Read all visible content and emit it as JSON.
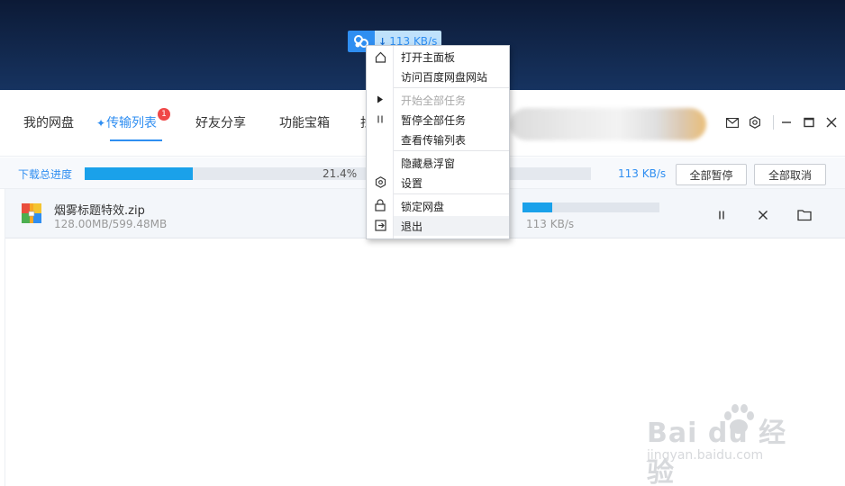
{
  "floating_ball": {
    "speed": "113 KB/s",
    "arrow": "↓"
  },
  "nav": {
    "tabs": [
      {
        "label": "我的网盘"
      },
      {
        "label": "传输列表",
        "badge": "1",
        "icon": "sparkle-icon"
      },
      {
        "label": "好友分享"
      },
      {
        "label": "功能宝箱"
      },
      {
        "label": "找"
      }
    ],
    "active_tab": "传输列表",
    "header_icons": [
      "mail-icon",
      "settings-icon",
      "minimize-icon",
      "maximize-icon",
      "close-icon"
    ]
  },
  "progress": {
    "label": "下载总进度",
    "percent": "21.4%",
    "fraction": 0.214,
    "speed": "113 KB/s",
    "pause_all_label": "全部暂停",
    "cancel_all_label": "全部取消"
  },
  "files": [
    {
      "name": "烟雾标题特效.zip",
      "size": "128.00MB/599.48MB",
      "progress_fraction": 0.214,
      "speed": "113 KB/s",
      "icon": "zip-archive-icon",
      "actions": [
        "pause-icon",
        "close-icon",
        "folder-icon"
      ]
    }
  ],
  "context_menu": {
    "items": [
      {
        "label": "打开主面板",
        "icon": "home-icon",
        "disabled": false
      },
      {
        "label": "访问百度网盘网站",
        "disabled": false
      },
      {
        "label": "开始全部任务",
        "icon": "play-icon",
        "disabled": true
      },
      {
        "label": "暂停全部任务",
        "icon": "pause-icon",
        "disabled": false
      },
      {
        "label": "查看传输列表",
        "disabled": false
      },
      {
        "label": "隐藏悬浮窗",
        "disabled": false
      },
      {
        "label": "设置",
        "icon": "settings-icon",
        "disabled": false
      },
      {
        "label": "锁定网盘",
        "icon": "lock-icon",
        "disabled": false
      },
      {
        "label": "退出",
        "icon": "exit-icon",
        "disabled": false,
        "hovered": true
      }
    ]
  },
  "watermark": {
    "main": "Bai  du 经验",
    "sub": "jingyan.baidu.com"
  },
  "colors": {
    "accent": "#2f8ef1",
    "progress": "#1aa1ea",
    "badge": "#f04848",
    "desktop": "#12284d"
  }
}
